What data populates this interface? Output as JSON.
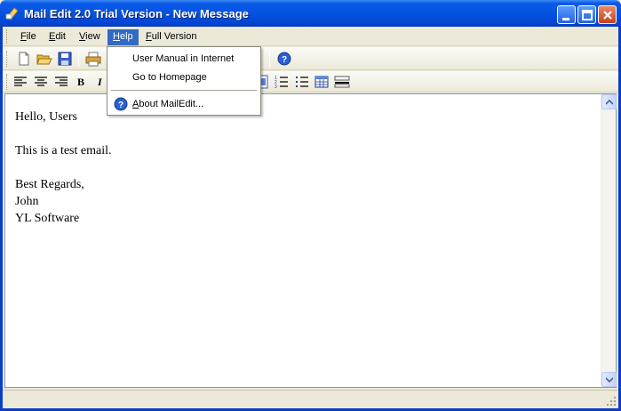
{
  "window": {
    "title": "Mail Edit 2.0 Trial Version - New Message"
  },
  "menubar": {
    "items": [
      {
        "label": "File",
        "mnemonic": "F",
        "rest": "ile"
      },
      {
        "label": "Edit",
        "mnemonic": "E",
        "rest": "dit"
      },
      {
        "label": "View",
        "mnemonic": "V",
        "rest": "iew"
      },
      {
        "label": "Help",
        "mnemonic": "H",
        "rest": "elp"
      },
      {
        "label": "Full Version",
        "mnemonic": "F",
        "rest": "ull Version"
      }
    ]
  },
  "help_menu": {
    "items": [
      {
        "label": "User Manual in Internet"
      },
      {
        "label": "Go to Homepage"
      },
      {
        "label": "About MailEdit...",
        "mnemonic": "A",
        "rest": "bout MailEdit..."
      }
    ]
  },
  "format_toolbar": {
    "bold_label": "B",
    "italic_label": "I"
  },
  "editor": {
    "lines": [
      "Hello, Users",
      "",
      "This is a test email.",
      "",
      "Best Regards,",
      "John",
      "YL Software"
    ]
  },
  "icons": {
    "app": "mail-edit-app-icon",
    "new": "new-document-icon",
    "open": "open-folder-icon",
    "save": "save-disk-icon",
    "print": "print-icon",
    "help": "help-icon"
  },
  "colors": {
    "titlebar": "#0553e1",
    "menu_highlight": "#316ac5",
    "window_bg": "#ece9d8"
  }
}
